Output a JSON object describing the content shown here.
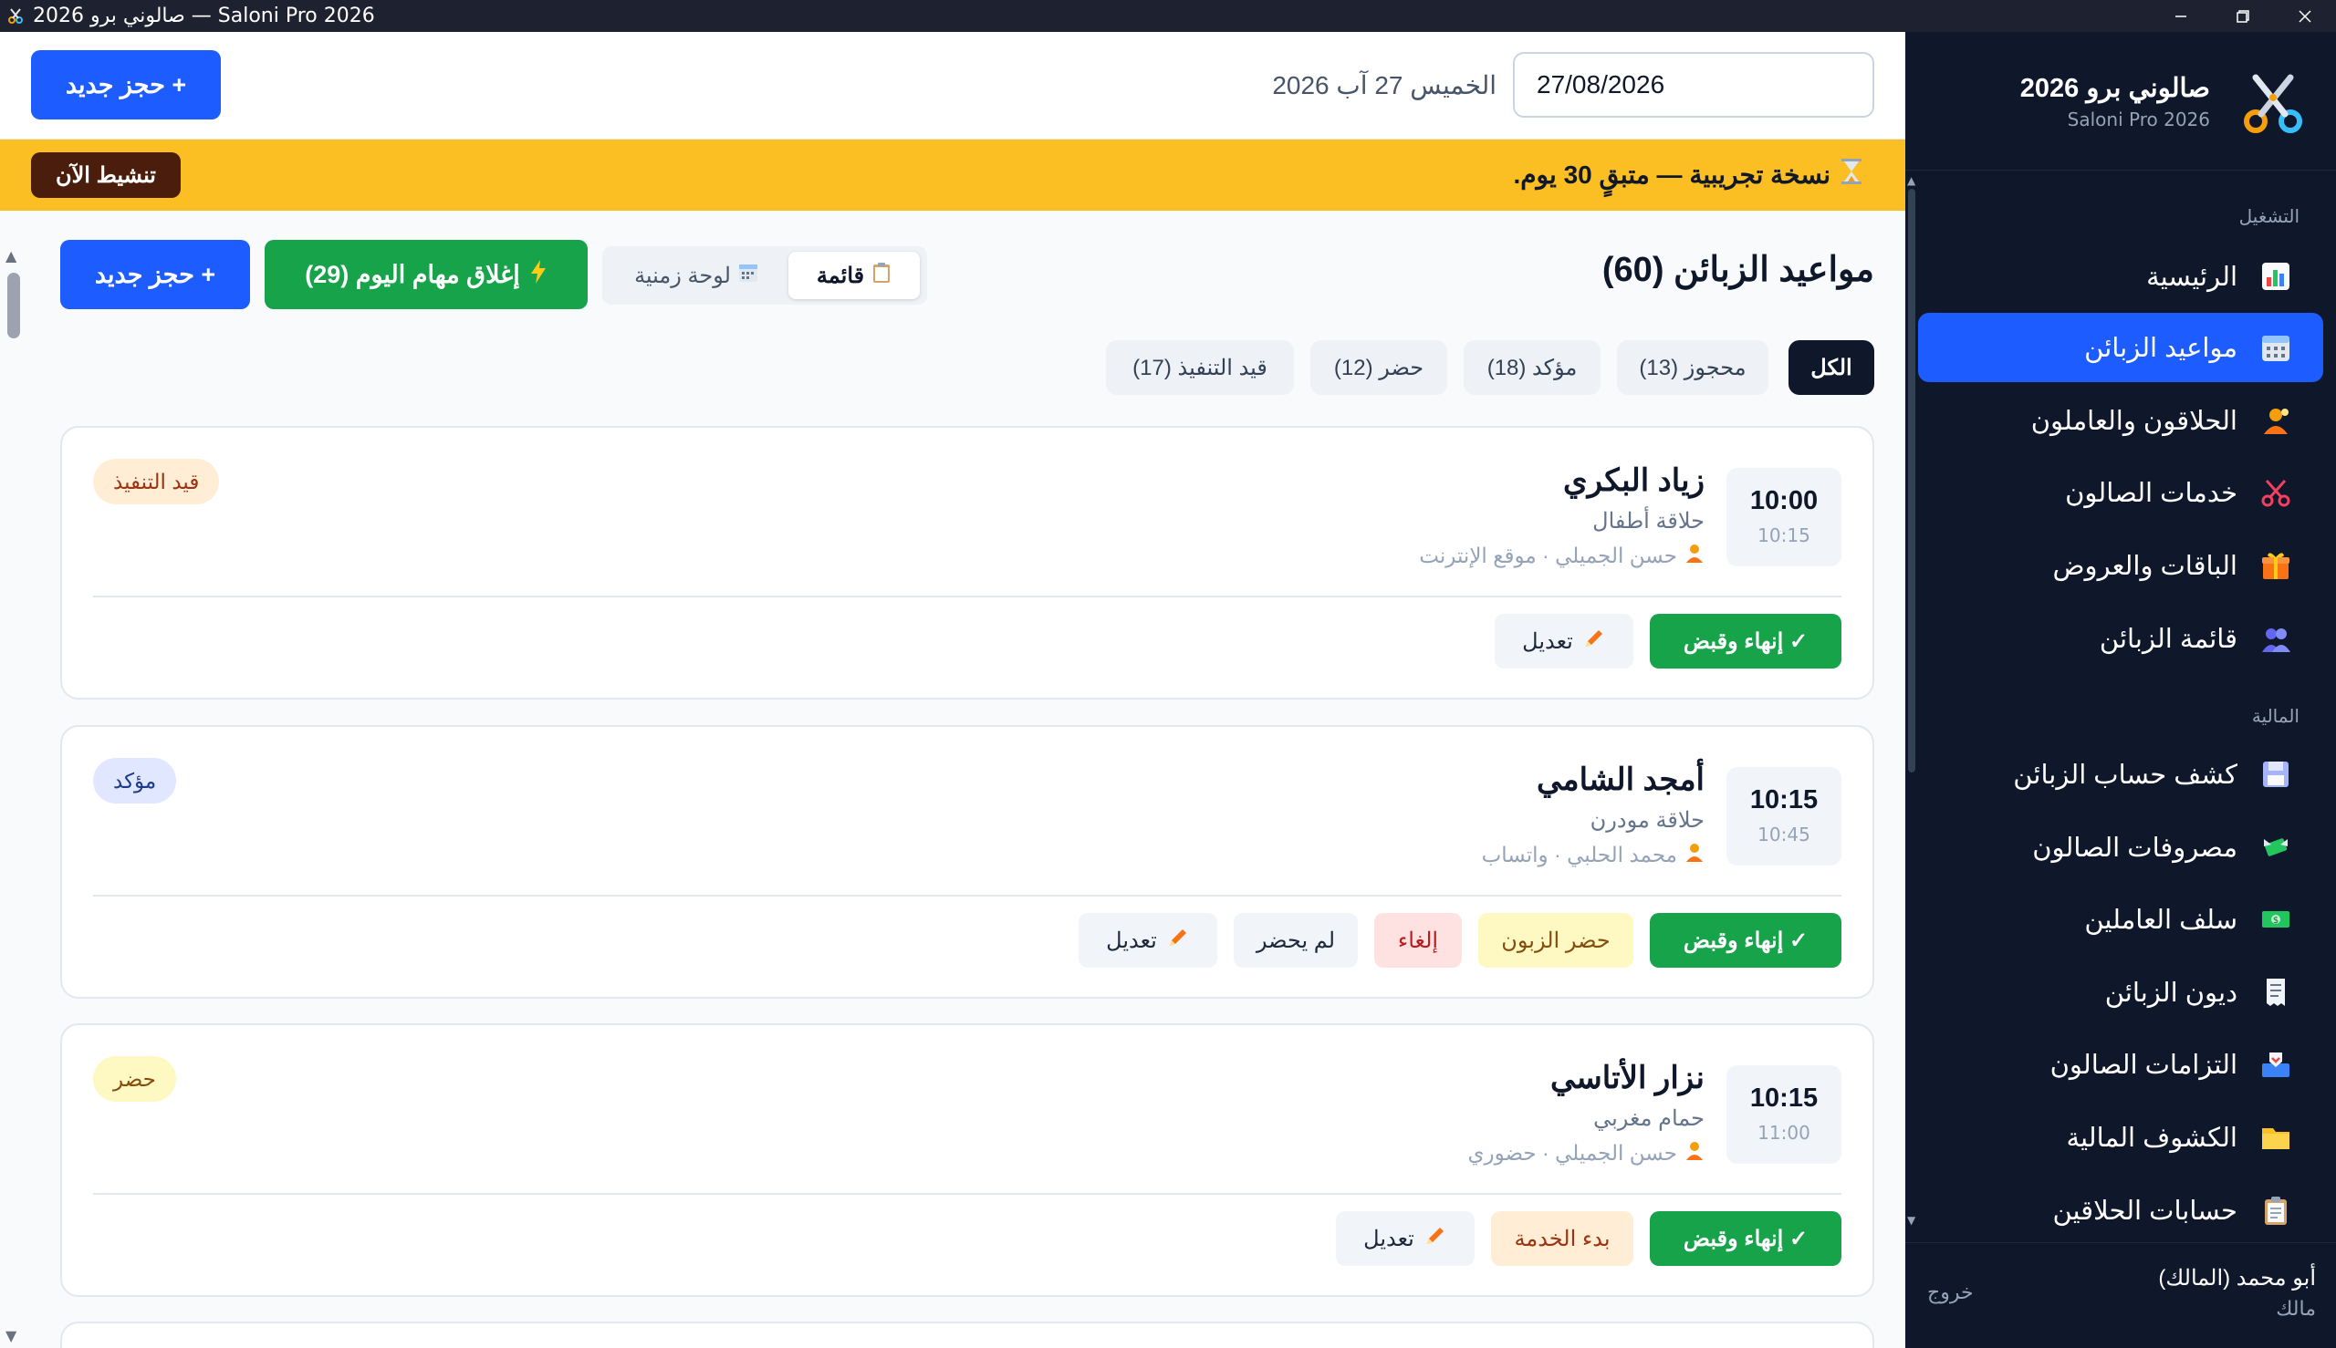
{
  "window": {
    "title": "صالوني برو 2026 — Saloni Pro 2026"
  },
  "sidebar": {
    "brand_title": "صالوني برو 2026",
    "brand_subtitle": "Saloni Pro 2026",
    "section_operation": "التشغيل",
    "section_finance": "المالية",
    "items": [
      {
        "label": "الرئيسية",
        "icon": "chart-icon"
      },
      {
        "label": "مواعيد الزبائن",
        "icon": "calendar-icon",
        "active": true
      },
      {
        "label": "الحلاقون والعاملون",
        "icon": "barber-icon"
      },
      {
        "label": "خدمات الصالون",
        "icon": "scissors-icon"
      },
      {
        "label": "الباقات والعروض",
        "icon": "gift-icon"
      },
      {
        "label": "قائمة الزبائن",
        "icon": "people-icon"
      },
      {
        "label": "كشف حساب الزبائن",
        "icon": "floppy-icon"
      },
      {
        "label": "مصروفات الصالون",
        "icon": "money-wings-icon"
      },
      {
        "label": "سلف العاملين",
        "icon": "dollar-bill-icon"
      },
      {
        "label": "ديون الزبائن",
        "icon": "receipt-icon"
      },
      {
        "label": "التزامات الصالون",
        "icon": "inbox-tray-icon"
      },
      {
        "label": "الكشوف المالية",
        "icon": "folder-icon"
      },
      {
        "label": "حسابات الحلاقين",
        "icon": "clipboard-icon"
      }
    ],
    "user_name": "أبو محمد (المالك)",
    "user_role": "مالك",
    "logout": "خروج"
  },
  "topbar": {
    "new_booking": "+ حجز جديد",
    "date_value": "27/08/2026",
    "date_label": "الخميس 27 آب 2026"
  },
  "trial": {
    "icon": "hourglass-icon",
    "text": "نسخة تجريبية — متبقٍ 30 يوم.",
    "activate": "تنشيط الآن"
  },
  "page": {
    "title": "مواعيد الزبائن (60)",
    "view_list": "قائمة",
    "view_timeline": "لوحة زمنية",
    "close_tasks": "إغلاق مهام اليوم (29)",
    "new_booking": "+ حجز جديد"
  },
  "filters": [
    {
      "label": "الكل",
      "active": true
    },
    {
      "label": "محجوز (13)"
    },
    {
      "label": "مؤكد (18)"
    },
    {
      "label": "حضر (12)"
    },
    {
      "label": "قيد التنفيذ (17)"
    }
  ],
  "appointments": [
    {
      "start": "10:00",
      "end": "10:15",
      "name": "زياد البكري",
      "service": "حلاقة أطفال",
      "meta": "حسن الجميلي · موقع الإنترنت",
      "status": "قيد التنفيذ",
      "actions": {
        "finish": "✓ إنهاء وقبض",
        "edit": "تعديل"
      }
    },
    {
      "start": "10:15",
      "end": "10:45",
      "name": "أمجد الشامي",
      "service": "حلاقة مودرن",
      "meta": "محمد الحلبي · واتساب",
      "status": "مؤكد",
      "actions": {
        "finish": "✓ إنهاء وقبض",
        "present": "حضر الزبون",
        "cancel": "إلغاء",
        "noshow": "لم يحضر",
        "edit": "تعديل"
      }
    },
    {
      "start": "10:15",
      "end": "11:00",
      "name": "نزار الأتاسي",
      "service": "حمام مغربي",
      "meta": "حسن الجميلي · حضوري",
      "status": "حضر",
      "actions": {
        "finish": "✓ إنهاء وقبض",
        "start": "بدء الخدمة",
        "edit": "تعديل"
      }
    }
  ],
  "colors": {
    "primary": "#1d5cff",
    "sidebar": "#0f172a",
    "trial_banner": "#fbbf24",
    "success": "#16a34a"
  }
}
